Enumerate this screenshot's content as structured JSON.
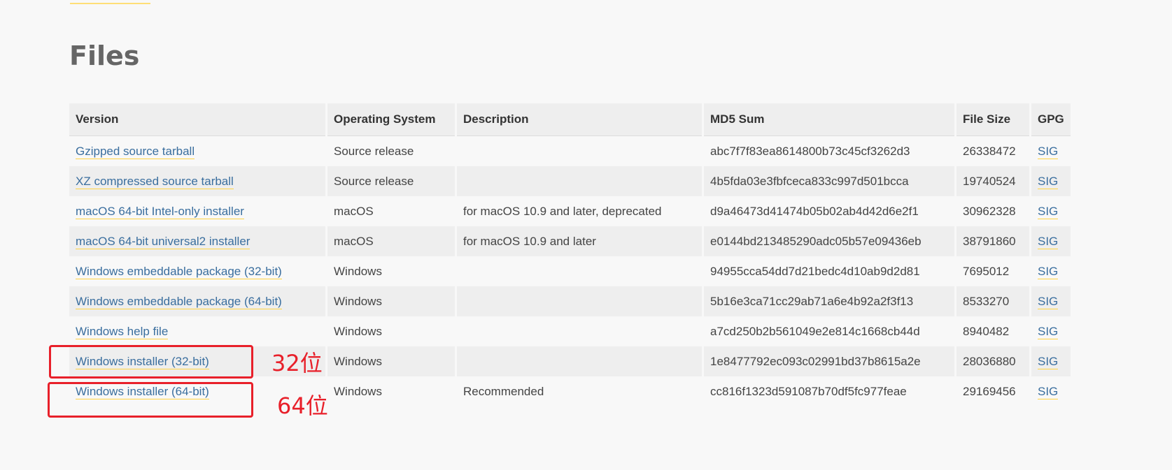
{
  "section_title": "Files",
  "table": {
    "headers": {
      "version": "Version",
      "os": "Operating System",
      "description": "Description",
      "md5": "MD5 Sum",
      "size": "File Size",
      "gpg": "GPG"
    },
    "rows": [
      {
        "version": "Gzipped source tarball",
        "os": "Source release",
        "description": "",
        "md5": "abc7f7f83ea8614800b73c45cf3262d3",
        "size": "26338472",
        "gpg": "SIG"
      },
      {
        "version": "XZ compressed source tarball",
        "os": "Source release",
        "description": "",
        "md5": "4b5fda03e3fbfceca833c997d501bcca",
        "size": "19740524",
        "gpg": "SIG"
      },
      {
        "version": "macOS 64-bit Intel-only installer",
        "os": "macOS",
        "description": "for macOS 10.9 and later, deprecated",
        "md5": "d9a46473d41474b05b02ab4d42d6e2f1",
        "size": "30962328",
        "gpg": "SIG"
      },
      {
        "version": "macOS 64-bit universal2 installer",
        "os": "macOS",
        "description": "for macOS 10.9 and later",
        "md5": "e0144bd213485290adc05b57e09436eb",
        "size": "38791860",
        "gpg": "SIG"
      },
      {
        "version": "Windows embeddable package (32-bit)",
        "os": "Windows",
        "description": "",
        "md5": "94955cca54dd7d21bedc4d10ab9d2d81",
        "size": "7695012",
        "gpg": "SIG"
      },
      {
        "version": "Windows embeddable package (64-bit)",
        "os": "Windows",
        "description": "",
        "md5": "5b16e3ca71cc29ab71a6e4b92a2f3f13",
        "size": "8533270",
        "gpg": "SIG"
      },
      {
        "version": "Windows help file",
        "os": "Windows",
        "description": "",
        "md5": "a7cd250b2b561049e2e814c1668cb44d",
        "size": "8940482",
        "gpg": "SIG"
      },
      {
        "version": "Windows installer (32-bit)",
        "os": "Windows",
        "description": "",
        "md5": "1e8477792ec093c02991bd37b8615a2e",
        "size": "28036880",
        "gpg": "SIG"
      },
      {
        "version": "Windows installer (64-bit)",
        "os": "Windows",
        "description": "Recommended",
        "md5": "cc816f1323d591087b70df5fc977feae",
        "size": "29169456",
        "gpg": "SIG"
      }
    ]
  },
  "annotations": {
    "label_32": "32位",
    "label_64": "64位",
    "color": "#e8202a"
  },
  "colors": {
    "link": "#3a6e9e",
    "link_underline": "#ffd343",
    "header_bg": "#eeeeee",
    "page_bg": "#f8f8f8"
  }
}
